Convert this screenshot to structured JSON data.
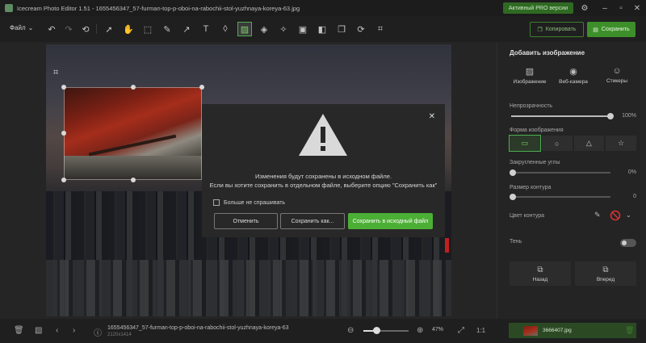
{
  "window": {
    "title": "Icecream Photo Editor 1.51 - 1655456347_57-furman-top-p-oboi-na-rabochii-stol-yuzhnaya-koreya-63.jpg",
    "pro_button": "Активный PRO версии"
  },
  "toolbar": {
    "file_menu": "Файл",
    "copy_label": "Копировать",
    "save_label": "Сохранить"
  },
  "dialog": {
    "line1": "Изменения будут сохранены в исходном файле.",
    "line2": "Если вы хотите сохранить в отдельном файле, выберите опцию \"Сохранить как\"",
    "checkbox_label": "Больше не спрашивать",
    "cancel": "Отменить",
    "save_as": "Сохранить как...",
    "save_original": "Сохранить в исходный файл"
  },
  "status": {
    "file_name": "1655456347_57-furman-top-p-oboi-na-rabochii-stol-yuzhnaya-koreya-63",
    "dimensions": "2120x1414",
    "zoom_percent": 47,
    "zoom": "47%",
    "actual_size": "1:1"
  },
  "panel": {
    "title": "Добавить изображение",
    "tabs": [
      "Изображение",
      "Веб-камера",
      "Стикеры"
    ],
    "opacity_label": "Непрозрачность",
    "opacity_value": "100%",
    "opacity_level": 1.0,
    "shape_label": "Форма изображения",
    "rounded_label": "Закругленные углы",
    "rounded_value": "0%",
    "border_size_label": "Размер контура",
    "border_size_value": "0",
    "border_color_label": "Цвет контура",
    "shadow_label": "Тень",
    "back_label": "Назад",
    "forward_label": "Вперед"
  },
  "layers": [
    {
      "name": "3666407.jpg"
    }
  ],
  "colors": {
    "accent": "#4caf35",
    "pro_button": "#2f6a23",
    "layer_active": "#2b4a24"
  }
}
